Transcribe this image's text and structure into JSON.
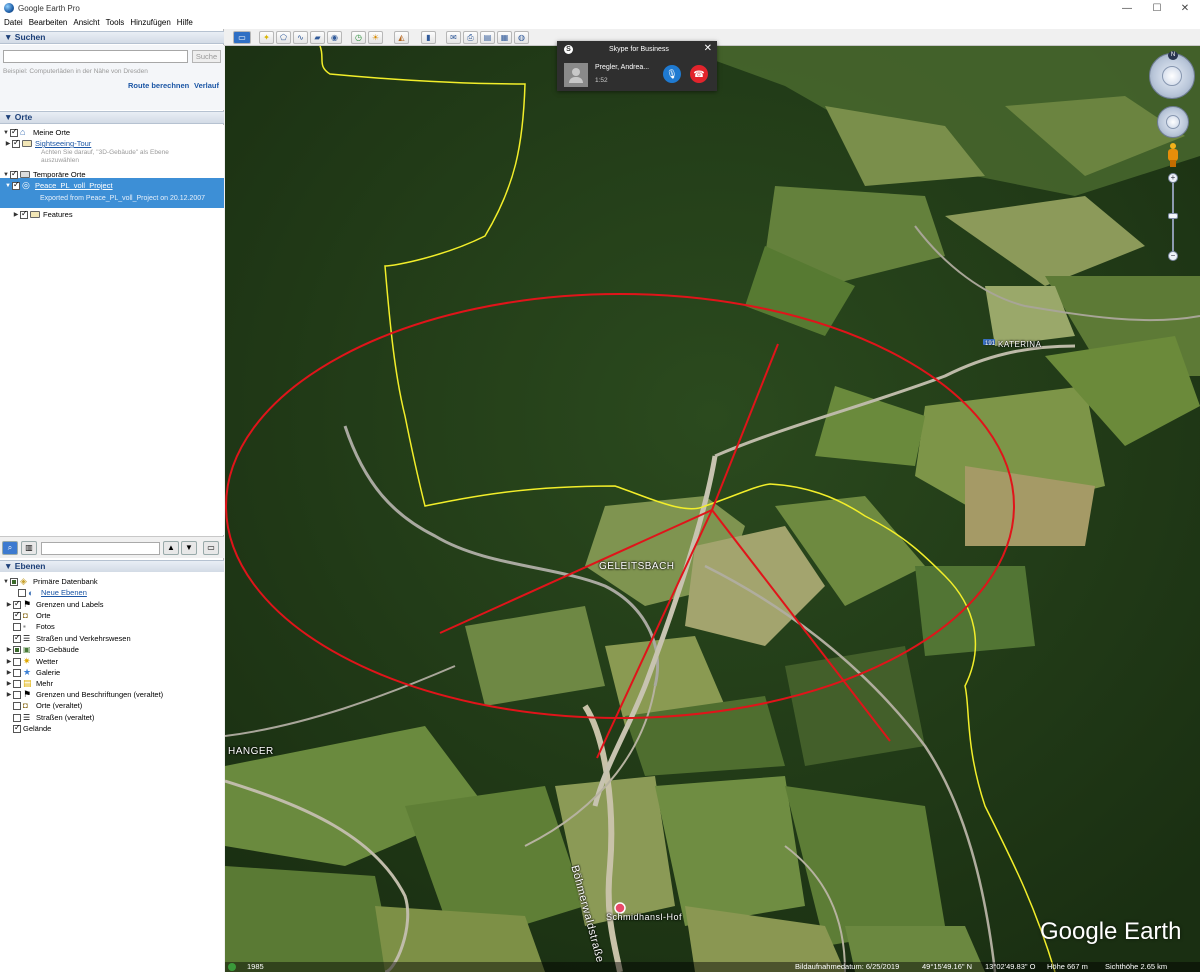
{
  "window": {
    "title": "Google Earth Pro",
    "controls": [
      "—",
      "☐",
      "✕"
    ]
  },
  "menu": {
    "items": [
      "Datei",
      "Bearbeiten",
      "Ansicht",
      "Tools",
      "Hinzufügen",
      "Hilfe"
    ]
  },
  "search": {
    "header": "▼ Suchen",
    "placeholder": "",
    "button": "Suche",
    "hint": "Beispiel: Computerläden in der Nähe von Dresden",
    "route_link": "Route berechnen",
    "history_link": "Verlauf"
  },
  "places": {
    "header": "▼ Orte",
    "my_places": "Meine Orte",
    "sightseeing": "Sightseeing-Tour",
    "sightseeing_note_1": "Achten Sie darauf, \"3D-Gebäude\" als Ebene",
    "sightseeing_note_2": "auszuwählen",
    "temp_places": "Temporäre Orte",
    "project": "Peace_PL_voll_Project",
    "project_desc": "Exported from Peace_PL_voll_Project on 20.12.2007",
    "features": "Features"
  },
  "layers": {
    "header": "▼ Ebenen",
    "items": [
      {
        "label": "Primäre Datenbank",
        "link": false
      },
      {
        "label": "Neue Ebenen",
        "link": true
      },
      {
        "label": "Grenzen und Labels",
        "link": false
      },
      {
        "label": "Orte",
        "link": false
      },
      {
        "label": "Fotos",
        "link": false
      },
      {
        "label": "Straßen und Verkehrswesen",
        "link": false
      },
      {
        "label": "3D-Gebäude",
        "link": false
      },
      {
        "label": "Wetter",
        "link": false
      },
      {
        "label": "Galerie",
        "link": false
      },
      {
        "label": "Mehr",
        "link": false
      },
      {
        "label": "Grenzen und Beschriftungen (veraltet)",
        "link": false
      },
      {
        "label": "Orte (veraltet)",
        "link": false
      },
      {
        "label": "Straßen (veraltet)",
        "link": false
      },
      {
        "label": "Gelände",
        "link": false
      }
    ]
  },
  "skype": {
    "title": "Skype for Business",
    "caller": "Pregler, Andrea...",
    "duration": "1:52",
    "logo": "S",
    "mic_glyph": "🎙",
    "hangup_glyph": "☎",
    "close_glyph": "✕"
  },
  "map": {
    "labels": {
      "geleitsbach": "GELEITSBACH",
      "hanger": "HANGER",
      "katerina": "KATERINA",
      "road": "Böhmerwaldstraße",
      "hof": "Schmidhansl-Hof",
      "compass_n": "N",
      "route_badge": "191"
    },
    "logo": "Google Earth",
    "colors": {
      "boundary": "#f2ee2a",
      "circle": "#e0141a"
    }
  },
  "status": {
    "year": "1985",
    "date": "Bildaufnahmedatum: 6/25/2019",
    "lat": "49°15'49.16\" N",
    "lon": "13°02'49.83\" O",
    "elev": "Höhe  667 m",
    "eye": "Sichthöhe  2.65 km"
  },
  "icons": [
    "app-globe-icon",
    "search-icon",
    "folder-icon",
    "globe-layer-icon",
    "compass-icon",
    "look-joystick-icon",
    "move-joystick-icon",
    "pegman-icon",
    "zoom-slider-icon",
    "mic-icon",
    "hangup-icon"
  ]
}
